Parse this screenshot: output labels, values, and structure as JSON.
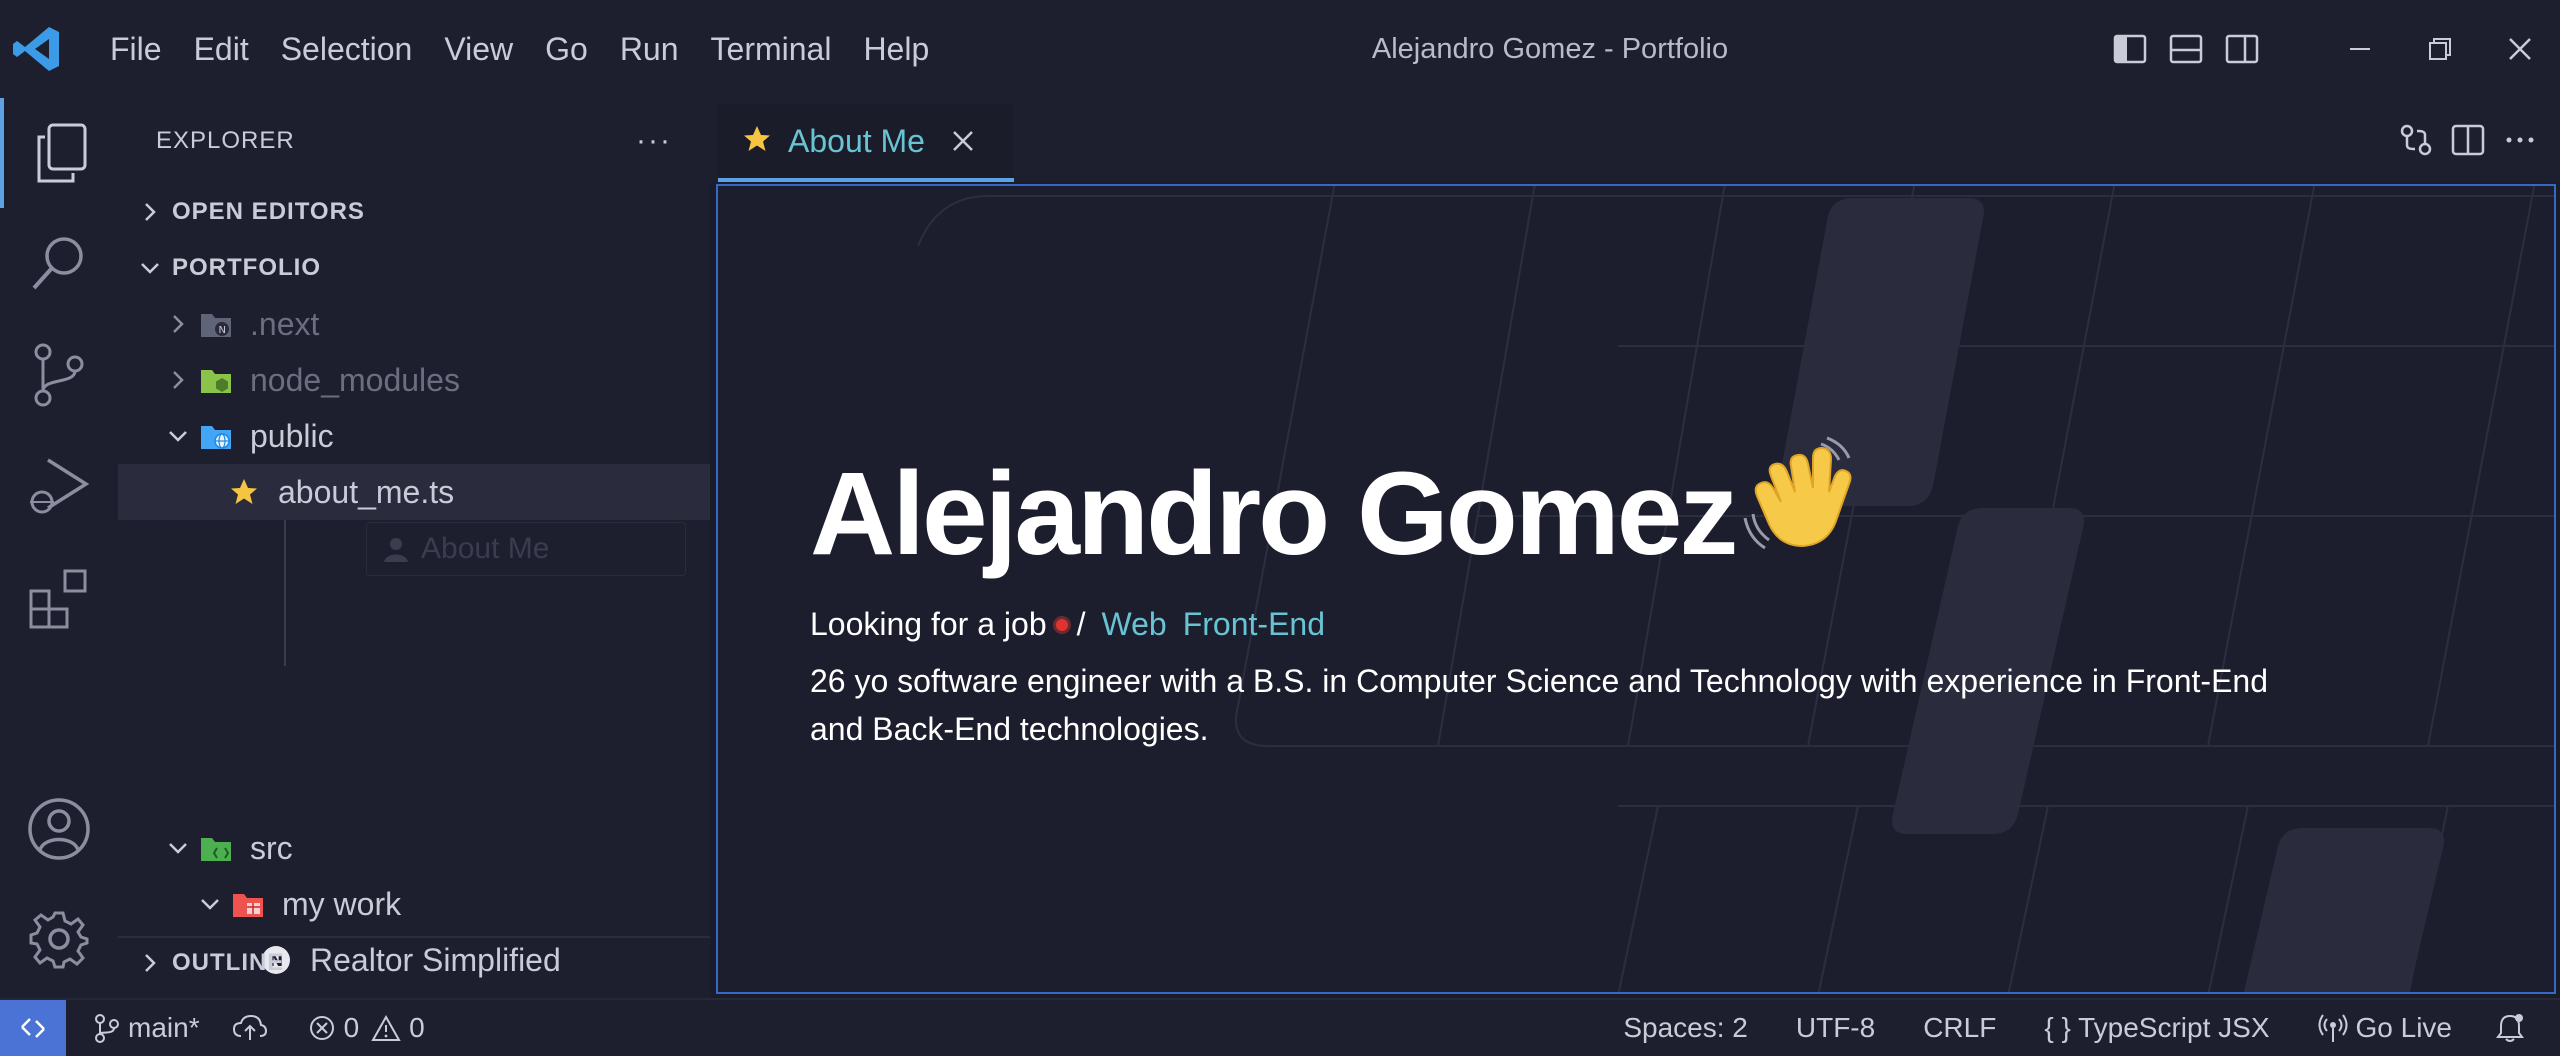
{
  "window": {
    "title": "Alejandro Gomez - Portfolio"
  },
  "menu": [
    "File",
    "Edit",
    "Selection",
    "View",
    "Go",
    "Run",
    "Terminal",
    "Help"
  ],
  "explorer": {
    "title": "EXPLORER",
    "more": "···",
    "open_editors": "OPEN EDITORS",
    "workspace": "PORTFOLIO",
    "tree": [
      {
        "label": ".next"
      },
      {
        "label": "node_modules"
      },
      {
        "label": "public"
      },
      {
        "label": "about_me.ts"
      },
      {
        "label": "src"
      },
      {
        "label": "my work"
      },
      {
        "label": "Realtor Simplified"
      }
    ],
    "ghost_label": "About Me",
    "outline": "OUTLINE"
  },
  "editor": {
    "tab_label": "About Me",
    "name": "Alejandro Gomez",
    "job_prefix": "Looking for a job",
    "job_sep": "/",
    "tags": [
      "Web",
      "Front-End"
    ],
    "bio": "26 yo software engineer with a B.S. in Computer Science and Technology with experience in Front-End and Back-End technologies."
  },
  "statusbar": {
    "branch": "main*",
    "errors": "0",
    "warnings": "0",
    "spaces": "Spaces: 2",
    "encoding": "UTF-8",
    "eol": "CRLF",
    "language": "{ } TypeScript JSX",
    "golive": "Go Live"
  },
  "colors": {
    "accent": "#5da3e3",
    "link": "#68c3d3",
    "status_remote": "#4b73d5"
  }
}
